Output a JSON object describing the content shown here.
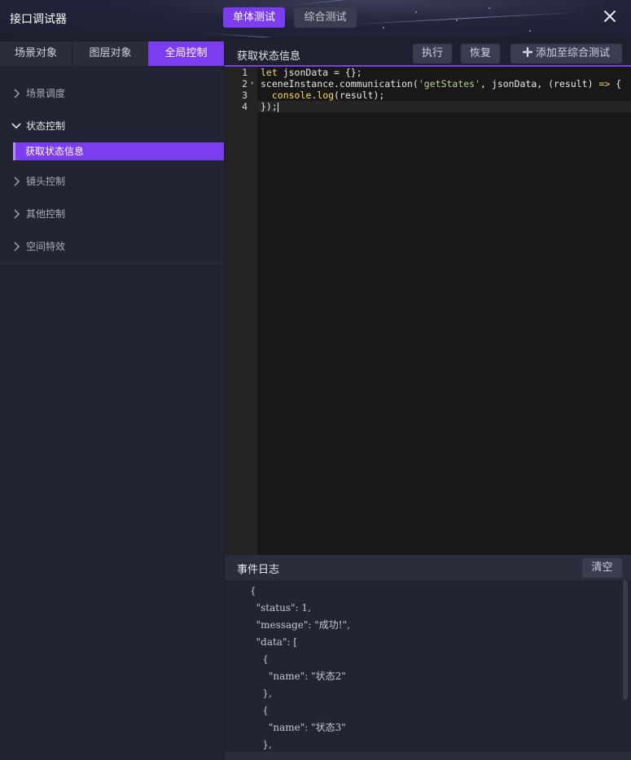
{
  "app": {
    "title": "接口调试器",
    "modes": [
      "单体测试",
      "综合测试"
    ]
  },
  "left": {
    "tabs": [
      "场景对象",
      "图层对象",
      "全局控制"
    ],
    "tree": [
      {
        "label": "场景调度",
        "open": false
      },
      {
        "label": "状态控制",
        "open": true,
        "children": [
          "获取状态信息"
        ]
      },
      {
        "label": "镜头控制",
        "open": false
      },
      {
        "label": "其他控制",
        "open": false
      },
      {
        "label": "空间特效",
        "open": false
      }
    ]
  },
  "main": {
    "title": "获取状态信息",
    "buttons": {
      "run": "执行",
      "restore": "恢复",
      "add": "添加至综合测试"
    }
  },
  "editor": {
    "line_numbers": [
      "1",
      "2",
      "3",
      "4"
    ],
    "lines": [
      "let jsonData = {};",
      "sceneInstance.communication('getStates', jsonData, (result) => {",
      "  console.log(result);",
      "});"
    ]
  },
  "log": {
    "title": "事件日志",
    "clear": "清空",
    "lines": [
      "{",
      "  \"status\": 1,",
      "  \"message\": \"成功!\",",
      "  \"data\": [",
      "    {",
      "      \"name\": \"状态2\"",
      "    },",
      "    {",
      "      \"name\": \"状态3\"",
      "    },"
    ]
  },
  "colors": {
    "accent": "#7c3cf0",
    "background": "#1d1f2b",
    "editor_bg": "#181818"
  }
}
